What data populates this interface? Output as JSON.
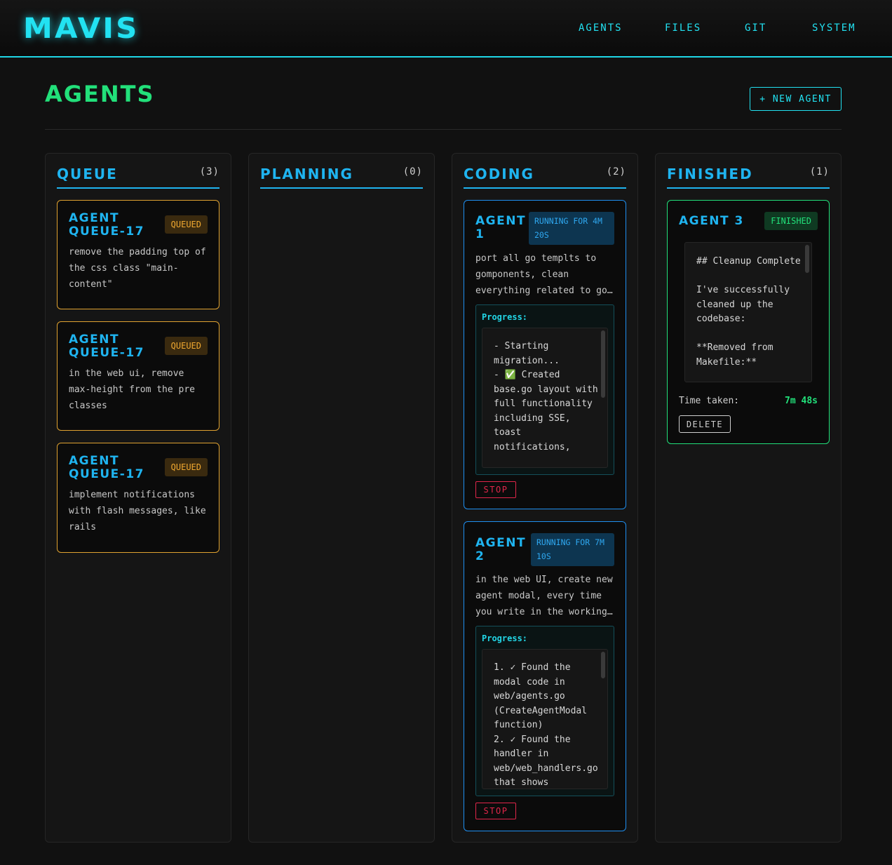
{
  "app": {
    "logo": "MAVIS"
  },
  "nav": {
    "agents": "AGENTS",
    "files": "FILES",
    "git": "GIT",
    "system": "SYSTEM"
  },
  "page": {
    "title": "AGENTS",
    "new_agent_label": "+ NEW AGENT"
  },
  "columns": {
    "queue": {
      "title": "QUEUE",
      "count": "(3)",
      "cards": [
        {
          "title": "AGENT QUEUE-17",
          "status": "QUEUED",
          "description": "remove the padding top of the css class \"main-content\""
        },
        {
          "title": "AGENT QUEUE-17",
          "status": "QUEUED",
          "description": "in the web ui, remove max-height from the pre classes"
        },
        {
          "title": "AGENT QUEUE-17",
          "status": "QUEUED",
          "description": "implement notifications with flash messages, like rails"
        }
      ]
    },
    "planning": {
      "title": "PLANNING",
      "count": "(0)"
    },
    "coding": {
      "title": "CODING",
      "count": "(2)",
      "cards": [
        {
          "title": "AGENT 1",
          "status": "RUNNING FOR 4M 20S",
          "description": "port all go templts to gomponents, clean everything related to go…",
          "progress_label": "Progress:",
          "progress_text": "- Starting migration...\n- ✅ Created base.go layout with full functionality including SSE, toast notifications,",
          "stop_label": "STOP"
        },
        {
          "title": "AGENT 2",
          "status": "RUNNING FOR 7M 10S",
          "description": "in the web UI, create new agent modal, every time you write in the working…",
          "progress_label": "Progress:",
          "progress_text": "1. ✓ Found the modal code in web/agents.go (CreateAgentModal function)\n2. ✓ Found the handler in web/web_handlers.go that shows",
          "stop_label": "STOP"
        }
      ]
    },
    "finished": {
      "title": "FINISHED",
      "count": "(1)",
      "cards": [
        {
          "title": "AGENT 3",
          "status": "FINISHED",
          "log_text": "## Cleanup Complete\n\nI've successfully cleaned up the codebase:\n\n**Removed from Makefile:**",
          "time_label": "Time taken:",
          "time_value": "7m 48s",
          "delete_label": "DELETE"
        }
      ]
    }
  },
  "colors": {
    "accent": "#22e2f2",
    "title_green": "#22e07a",
    "queued": "#e0a230",
    "running": "#1f8ff0",
    "stop": "#e0264a"
  }
}
